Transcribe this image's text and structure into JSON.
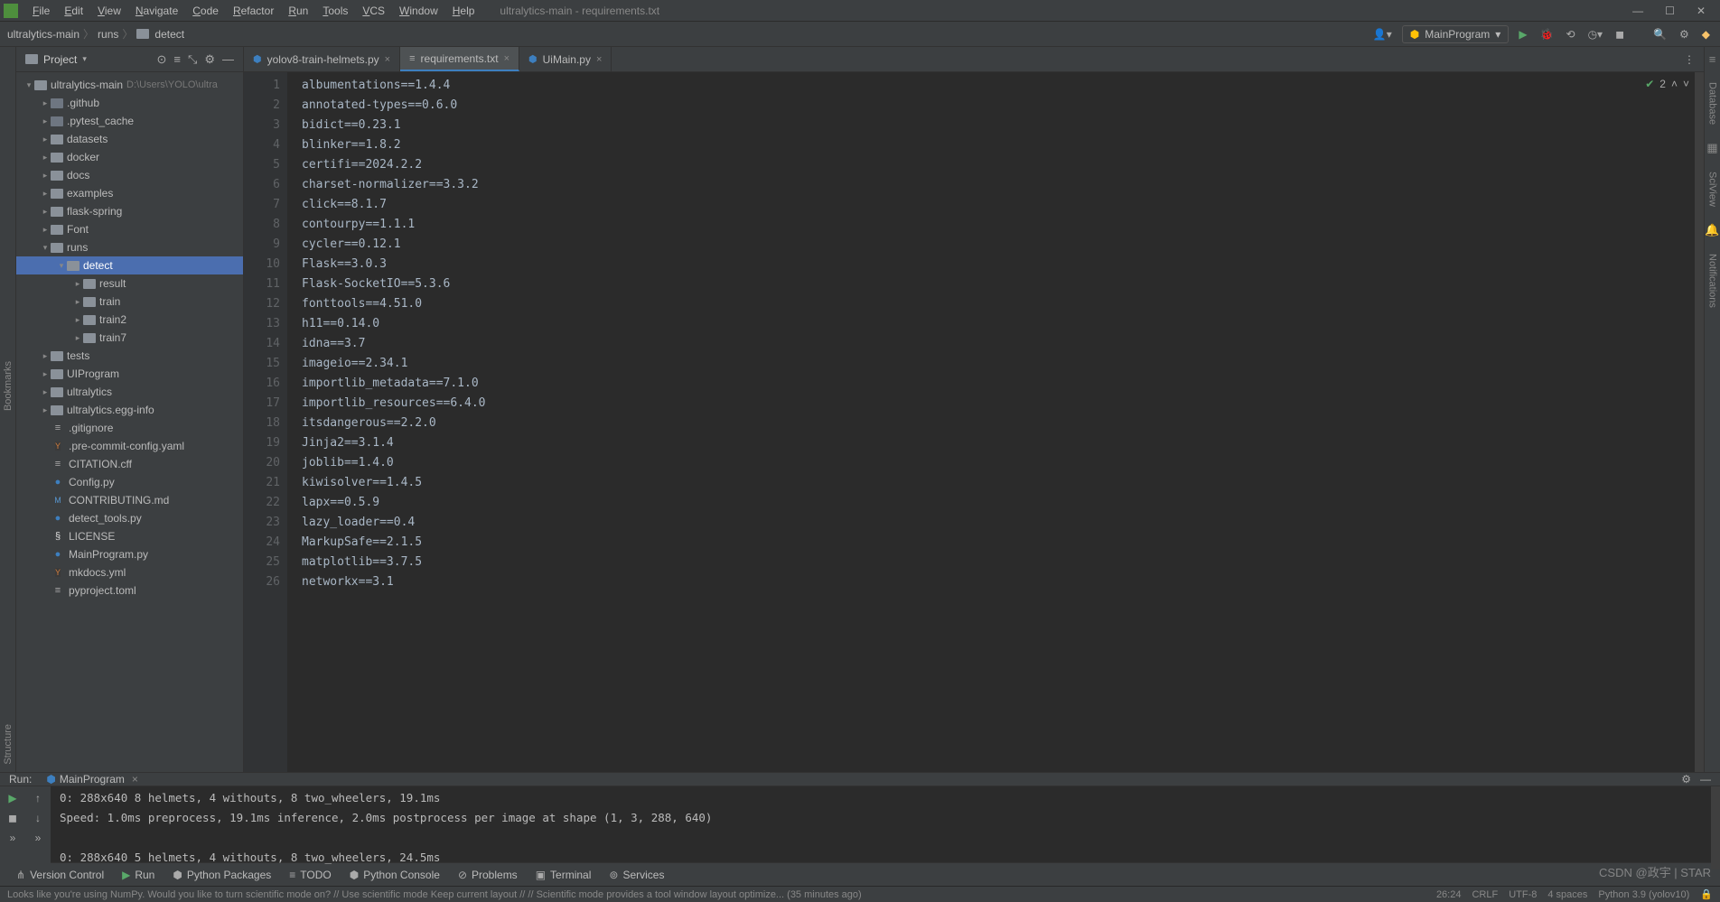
{
  "window": {
    "title": "ultralytics-main - requirements.txt"
  },
  "menu": [
    "File",
    "Edit",
    "View",
    "Navigate",
    "Code",
    "Refactor",
    "Run",
    "Tools",
    "VCS",
    "Window",
    "Help"
  ],
  "breadcrumbs": [
    "ultralytics-main",
    "runs",
    "detect"
  ],
  "runConfig": {
    "name": "MainProgram"
  },
  "project": {
    "title": "Project",
    "root": {
      "name": "ultralytics-main",
      "path": "D:\\Users\\YOLO\\ultra"
    },
    "tree": [
      {
        "d": 1,
        "arr": "right",
        "ico": "folder-dot",
        "name": ".github"
      },
      {
        "d": 1,
        "arr": "right",
        "ico": "folder-dot",
        "name": ".pytest_cache"
      },
      {
        "d": 1,
        "arr": "right",
        "ico": "folder",
        "name": "datasets"
      },
      {
        "d": 1,
        "arr": "right",
        "ico": "folder",
        "name": "docker"
      },
      {
        "d": 1,
        "arr": "right",
        "ico": "folder",
        "name": "docs"
      },
      {
        "d": 1,
        "arr": "right",
        "ico": "folder",
        "name": "examples"
      },
      {
        "d": 1,
        "arr": "right",
        "ico": "folder",
        "name": "flask-spring"
      },
      {
        "d": 1,
        "arr": "right",
        "ico": "folder",
        "name": "Font"
      },
      {
        "d": 1,
        "arr": "down",
        "ico": "folder",
        "name": "runs"
      },
      {
        "d": 2,
        "arr": "down",
        "ico": "folder",
        "name": "detect",
        "sel": true
      },
      {
        "d": 3,
        "arr": "right",
        "ico": "folder",
        "name": "result"
      },
      {
        "d": 3,
        "arr": "right",
        "ico": "folder",
        "name": "train"
      },
      {
        "d": 3,
        "arr": "right",
        "ico": "folder",
        "name": "train2"
      },
      {
        "d": 3,
        "arr": "right",
        "ico": "folder",
        "name": "train7"
      },
      {
        "d": 1,
        "arr": "right",
        "ico": "folder",
        "name": "tests"
      },
      {
        "d": 1,
        "arr": "right",
        "ico": "folder",
        "name": "UIProgram"
      },
      {
        "d": 1,
        "arr": "right",
        "ico": "folder",
        "name": "ultralytics"
      },
      {
        "d": 1,
        "arr": "right",
        "ico": "folder",
        "name": "ultralytics.egg-info"
      },
      {
        "d": 1,
        "arr": "none",
        "ico": "txt",
        "name": ".gitignore"
      },
      {
        "d": 1,
        "arr": "none",
        "ico": "yaml",
        "name": ".pre-commit-config.yaml"
      },
      {
        "d": 1,
        "arr": "none",
        "ico": "txt",
        "name": "CITATION.cff"
      },
      {
        "d": 1,
        "arr": "none",
        "ico": "py",
        "name": "Config.py"
      },
      {
        "d": 1,
        "arr": "none",
        "ico": "md",
        "name": "CONTRIBUTING.md"
      },
      {
        "d": 1,
        "arr": "none",
        "ico": "py",
        "name": "detect_tools.py"
      },
      {
        "d": 1,
        "arr": "none",
        "ico": "lic",
        "name": "LICENSE"
      },
      {
        "d": 1,
        "arr": "none",
        "ico": "py",
        "name": "MainProgram.py"
      },
      {
        "d": 1,
        "arr": "none",
        "ico": "yaml",
        "name": "mkdocs.yml"
      },
      {
        "d": 1,
        "arr": "none",
        "ico": "txt",
        "name": "pyproject.toml"
      }
    ]
  },
  "tabs": [
    {
      "ico": "py",
      "name": "yolov8-train-helmets.py",
      "active": false
    },
    {
      "ico": "txt",
      "name": "requirements.txt",
      "active": true
    },
    {
      "ico": "py",
      "name": "UiMain.py",
      "active": false
    }
  ],
  "editor": {
    "problems": "2",
    "lines": [
      "albumentations==1.4.4",
      "annotated-types==0.6.0",
      "bidict==0.23.1",
      "blinker==1.8.2",
      "certifi==2024.2.2",
      "charset-normalizer==3.3.2",
      "click==8.1.7",
      "contourpy==1.1.1",
      "cycler==0.12.1",
      "Flask==3.0.3",
      "Flask-SocketIO==5.3.6",
      "fonttools==4.51.0",
      "h11==0.14.0",
      "idna==3.7",
      "imageio==2.34.1",
      "importlib_metadata==7.1.0",
      "importlib_resources==6.4.0",
      "itsdangerous==2.2.0",
      "Jinja2==3.1.4",
      "joblib==1.4.0",
      "kiwisolver==1.4.5",
      "lapx==0.5.9",
      "lazy_loader==0.4",
      "MarkupSafe==2.1.5",
      "matplotlib==3.7.5",
      "networkx==3.1"
    ]
  },
  "rightTabs": [
    "Database",
    "SciView",
    "Notifications"
  ],
  "run": {
    "label": "Run:",
    "tab": "MainProgram",
    "output": [
      "0: 288x640 8 helmets, 4 withouts, 8 two_wheelers, 19.1ms",
      "Speed: 1.0ms preprocess, 19.1ms inference, 2.0ms postprocess per image at shape (1, 3, 288, 640)",
      "",
      "0: 288x640 5 helmets, 4 withouts, 8 two_wheelers, 24.5ms"
    ]
  },
  "bottomTabs": [
    {
      "ico": "vc",
      "label": "Version Control"
    },
    {
      "ico": "green-play",
      "label": "Run"
    },
    {
      "ico": "pkg",
      "label": "Python Packages"
    },
    {
      "ico": "todo",
      "label": "TODO"
    },
    {
      "ico": "py",
      "label": "Python Console"
    },
    {
      "ico": "prob",
      "label": "Problems"
    },
    {
      "ico": "term",
      "label": "Terminal"
    },
    {
      "ico": "svc",
      "label": "Services"
    }
  ],
  "status": {
    "msg": "Looks like you're using NumPy. Would you like to turn scientific mode on? // Use scientific mode    Keep current layout  // // Scientific mode provides a tool window layout optimize... (35 minutes ago)",
    "pos": "26:24",
    "crlf": "CRLF",
    "enc": "UTF-8",
    "indent": "4 spaces",
    "interp": "Python 3.9 (yolov10)"
  },
  "watermark": "CSDN @政宇 | STAR"
}
